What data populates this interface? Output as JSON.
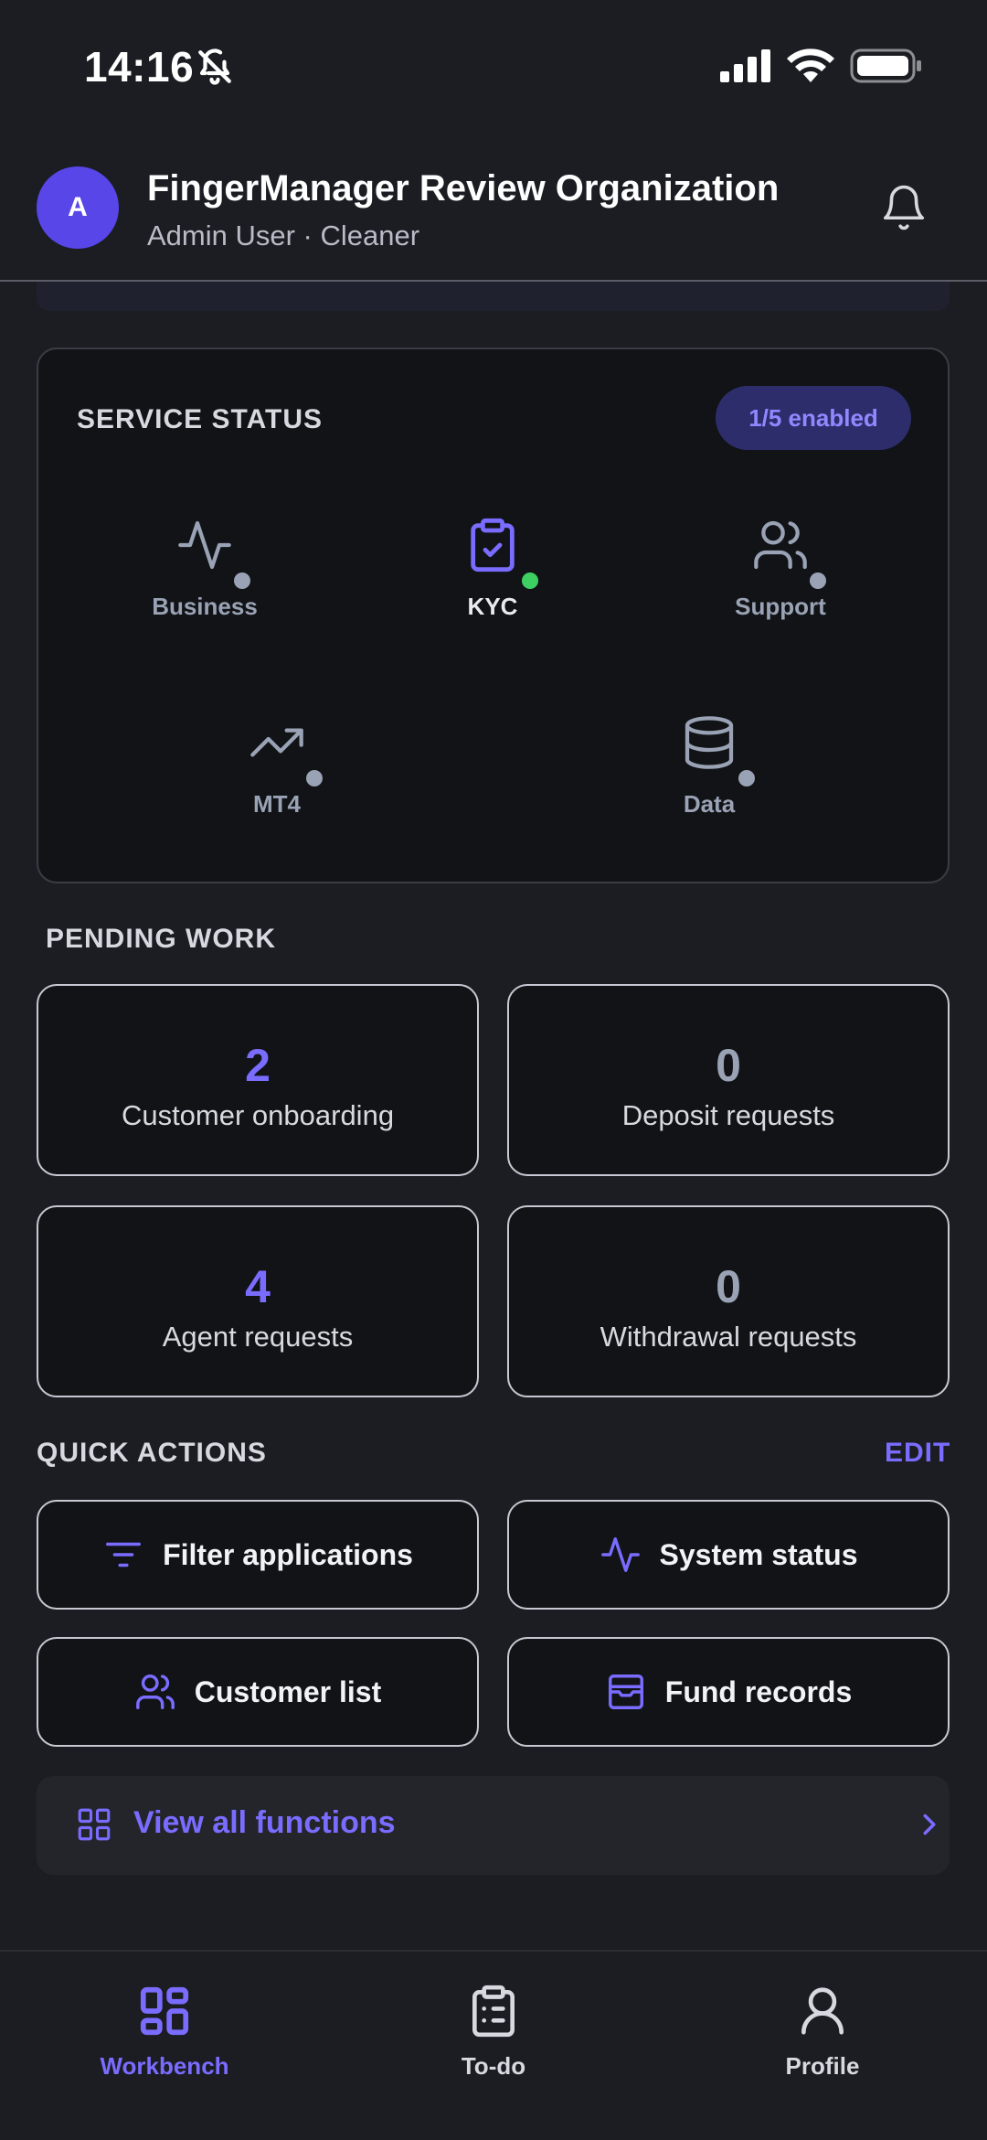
{
  "status_bar": {
    "time": "14:16"
  },
  "header": {
    "avatar_letter": "A",
    "org_name": "FingerManager Review Organization",
    "role": "Admin User · Cleaner"
  },
  "service_status": {
    "title": "SERVICE STATUS",
    "badge": "1/5 enabled",
    "items": [
      {
        "label": "Business",
        "icon": "activity-icon",
        "enabled": false
      },
      {
        "label": "KYC",
        "icon": "clipboard-check-icon",
        "enabled": true
      },
      {
        "label": "Support",
        "icon": "users-icon",
        "enabled": false
      },
      {
        "label": "MT4",
        "icon": "trending-up-icon",
        "enabled": false
      },
      {
        "label": "Data",
        "icon": "database-icon",
        "enabled": false
      }
    ]
  },
  "pending_work": {
    "title": "PENDING WORK",
    "cards": [
      {
        "count": "2",
        "label": "Customer onboarding"
      },
      {
        "count": "0",
        "label": "Deposit requests"
      },
      {
        "count": "4",
        "label": "Agent requests"
      },
      {
        "count": "0",
        "label": "Withdrawal requests"
      }
    ]
  },
  "quick_actions": {
    "title": "QUICK ACTIONS",
    "edit_label": "EDIT",
    "actions": [
      {
        "label": "Filter applications",
        "icon": "filter-icon"
      },
      {
        "label": "System status",
        "icon": "activity-icon"
      },
      {
        "label": "Customer list",
        "icon": "users-icon"
      },
      {
        "label": "Fund records",
        "icon": "archive-icon"
      }
    ],
    "view_all": "View all functions"
  },
  "tabs": [
    {
      "label": "Workbench",
      "icon": "grid-icon",
      "active": true
    },
    {
      "label": "To-do",
      "icon": "clipboard-list-icon",
      "active": false
    },
    {
      "label": "Profile",
      "icon": "user-icon",
      "active": false
    }
  ],
  "colors": {
    "accent": "#7a6cff",
    "enabled_dot": "#3ecf63",
    "muted": "#9aa3b5",
    "background": "#1b1d22",
    "card": "#111316"
  }
}
